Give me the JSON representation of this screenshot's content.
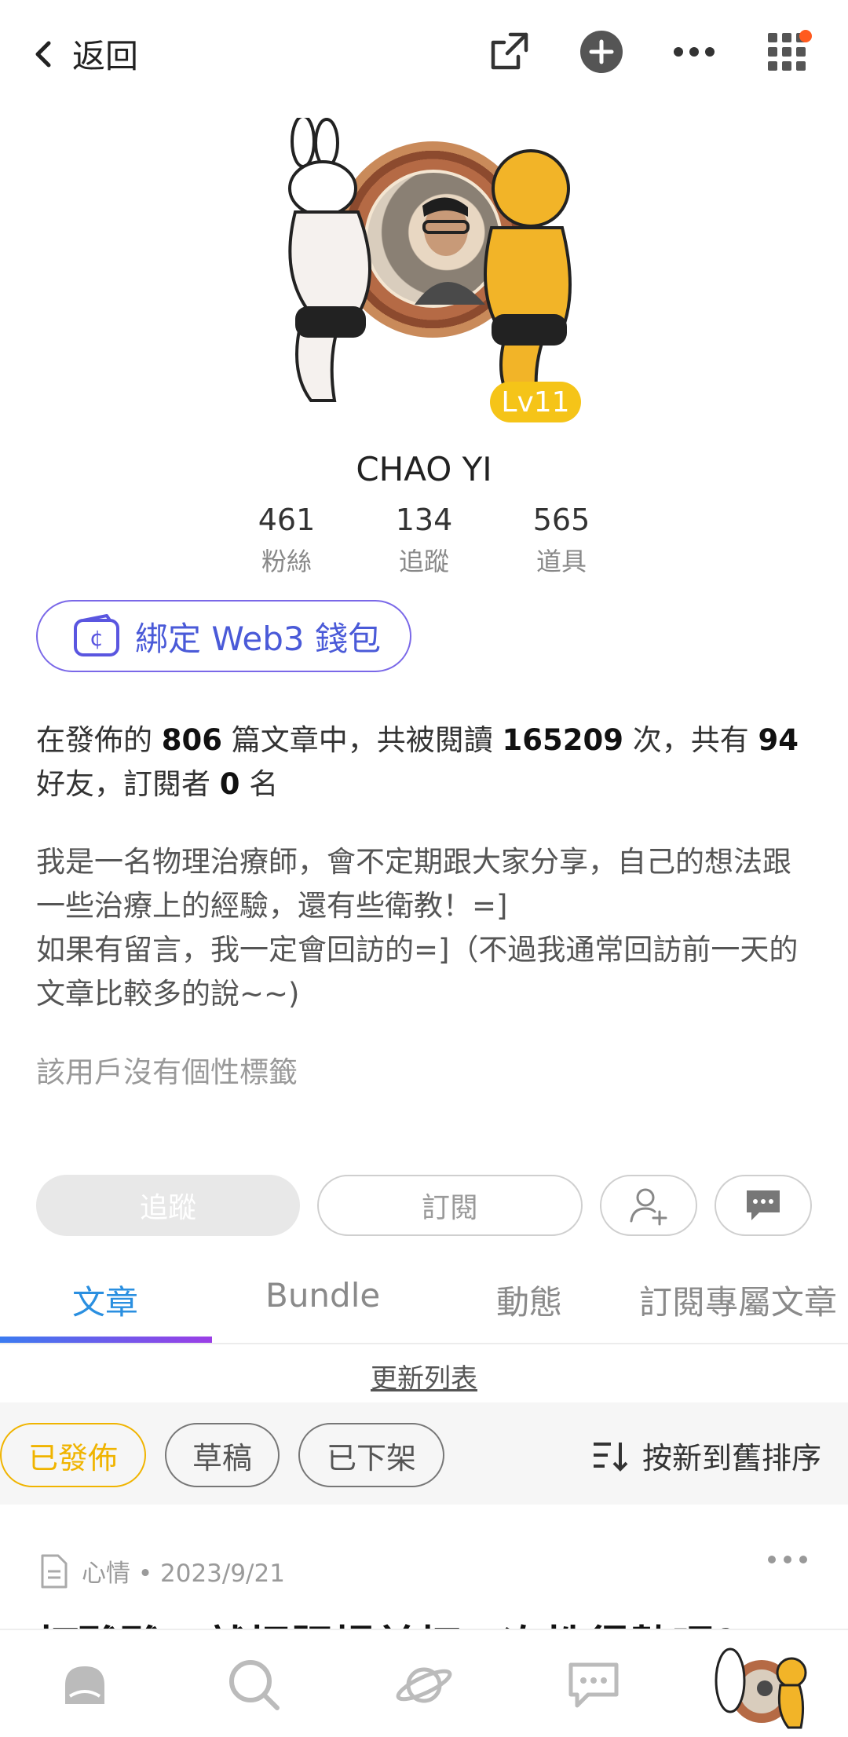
{
  "header": {
    "back_label": "返回",
    "icons": [
      "back-arrow-icon",
      "share-icon",
      "add-icon",
      "more-icon",
      "apps-grid-icon"
    ],
    "notify_color": "#ff5a1f"
  },
  "profile": {
    "level": "Lv11",
    "name": "CHAO YI",
    "stats": [
      {
        "value": "461",
        "label": "粉絲"
      },
      {
        "value": "134",
        "label": "追蹤"
      },
      {
        "value": "565",
        "label": "道具"
      }
    ],
    "web3_label": "綁定 Web3 錢包",
    "summary": {
      "prefix": "在發佈的 ",
      "articles": "806",
      "mid1": " 篇文章中，共被閱讀 ",
      "reads": "165209",
      "mid2": " 次，共有 ",
      "friends": "94",
      "mid3": " 好友，訂閱者 ",
      "subscribers": "0",
      "suffix": " 名"
    },
    "bio_line1": "我是一名物理治療師，會不定期跟大家分享，自己的想法跟一些治療上的經驗，還有些衛教！=]",
    "bio_line2": "如果有留言，我一定會回訪的=]（不過我通常回訪前一天的文章比較多的說~~)",
    "tags_text": "該用戶沒有個性標籤"
  },
  "actions": {
    "follow": "追蹤",
    "subscribe": "訂閱"
  },
  "tabs": [
    {
      "label": "文章",
      "active": true
    },
    {
      "label": "Bundle",
      "active": false
    },
    {
      "label": "動態",
      "active": false
    },
    {
      "label": "訂閱專屬文章",
      "active": false
    }
  ],
  "refresh_label": "更新列表",
  "filters": {
    "chips": [
      {
        "label": "已發佈",
        "active": true
      },
      {
        "label": "草稿",
        "active": false
      },
      {
        "label": "已下架",
        "active": false
      }
    ],
    "sort_label": "按新到舊排序"
  },
  "post": {
    "meta": "心情 • 2023/9/21",
    "title": "打酸酸，就把肥揚前打一次性得勢呢？"
  },
  "colors": {
    "accent": "#2a8fe0",
    "level": "#f5c418",
    "chip_active": "#f0b400",
    "web3": "#4a5ad8"
  }
}
